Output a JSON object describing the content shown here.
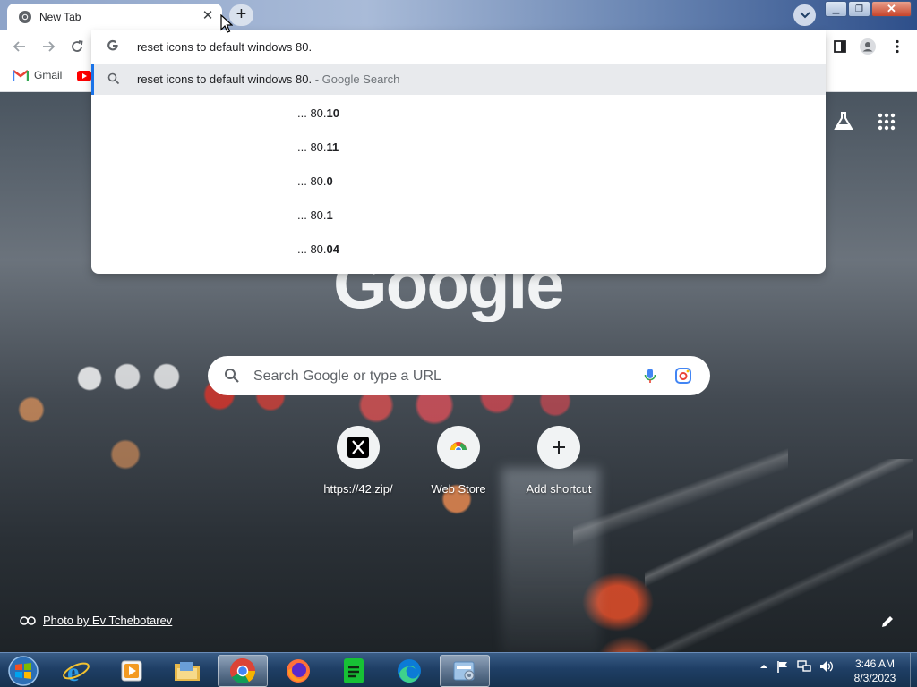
{
  "browser": {
    "tab": {
      "title": "New Tab"
    },
    "address_bar": {
      "typed_text": "reset icons to default windows 80."
    },
    "bookmarks": [
      {
        "label": "Gmail",
        "icon": "gmail-icon"
      },
      {
        "label": "",
        "icon": "youtube-icon"
      }
    ]
  },
  "omnibox": {
    "highlighted": {
      "text": "reset icons to default windows 80.",
      "description": " - Google Search",
      "icon": "search-icon"
    },
    "suggestions": [
      {
        "prefix": "... 80.",
        "bold": "10"
      },
      {
        "prefix": "... 80.",
        "bold": "11"
      },
      {
        "prefix": "... 80.",
        "bold": "0"
      },
      {
        "prefix": "... 80.",
        "bold": "1"
      },
      {
        "prefix": "... 80.",
        "bold": "04"
      }
    ]
  },
  "ntp": {
    "logo_text": "Google",
    "search_placeholder": "Search Google or type a URL",
    "shortcuts": [
      {
        "label": "https://42.zip/",
        "icon": "x-logo-icon"
      },
      {
        "label": "Web Store",
        "icon": "web-store-icon"
      },
      {
        "label": "Add shortcut",
        "icon": "plus-icon"
      }
    ],
    "photo_credit": "Photo by Ev Tchebotarev"
  },
  "taskbar": {
    "apps": [
      {
        "name": "internet-explorer",
        "icon": "ie-icon"
      },
      {
        "name": "media-player",
        "icon": "media-icon"
      },
      {
        "name": "file-explorer",
        "icon": "folder-icon"
      },
      {
        "name": "chrome",
        "icon": "chrome-icon",
        "active": true
      },
      {
        "name": "firefox",
        "icon": "firefox-icon"
      },
      {
        "name": "spreadsheets",
        "icon": "sheets-icon"
      },
      {
        "name": "edge",
        "icon": "edge-icon"
      },
      {
        "name": "control-panel",
        "icon": "control-panel-icon"
      }
    ],
    "clock": {
      "time": "3:46 AM",
      "date": "8/3/2023"
    }
  },
  "colors": {
    "accent": "#1a73e8",
    "taskbar": "#1f3f66"
  }
}
